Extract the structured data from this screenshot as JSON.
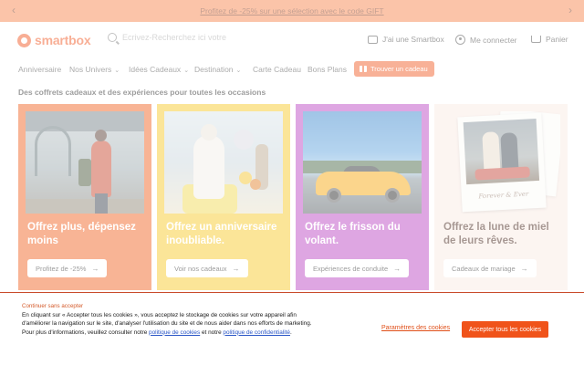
{
  "promo": {
    "text": "Profitez de -25% sur une sélection avec le code GIFT",
    "prev_icon": "chevron-left",
    "next_icon": "chevron-right"
  },
  "header": {
    "logo": "smartbox",
    "search_placeholder": "Ecrivez-Recherchez ici votre",
    "have_box_label": "J'ai une Smartbox",
    "login_label": "Me connecter",
    "cart_label": "Panier"
  },
  "nav": {
    "items": [
      {
        "label": "Anniversaire",
        "dropdown": false
      },
      {
        "label": "Nos Univers",
        "dropdown": true
      },
      {
        "label": "Idées Cadeaux",
        "dropdown": true
      },
      {
        "label": "Destination",
        "dropdown": true
      },
      {
        "label": "Carte Cadeau",
        "dropdown": false
      },
      {
        "label": "Bons Plans",
        "dropdown": false
      }
    ],
    "cta_label": "Trouver un cadeau",
    "chevron": "⌄"
  },
  "heading": "Des coffrets cadeaux et des expériences pour toutes les occasions",
  "cards": [
    {
      "title": "Offrez plus, dépensez moins",
      "cta": "Profitez de -25%"
    },
    {
      "title": "Offrez un anniversaire inoubliable.",
      "cta": "Voir nos cadeaux"
    },
    {
      "title": "Offrez le frisson du volant.",
      "cta": "Expériences de conduite"
    },
    {
      "title": "Offrez la lune de miel de leurs rêves.",
      "cta": "Cadeaux de mariage"
    }
  ],
  "card_photo4_caption": "Forever & Ever",
  "cookie": {
    "continue_label": "Continuer sans accepter",
    "text_before": "En cliquant sur « Accepter tous les cookies », vous acceptez le stockage de cookies sur votre appareil afin d'améliorer la navigation sur le site, d'analyser l'utilisation du site et de nous aider dans nos efforts de marketing. Pour plus d'informations, veuillez consulter notre ",
    "link_1": "politique de cookies",
    "text_middle": " et notre ",
    "link_2": "politique de confidentialité",
    "text_after": ".",
    "settings_label": "Paramètres des cookies",
    "accept_label": "Accepter tous les cookies"
  },
  "colors": {
    "brand": "#ef4d14",
    "promo_bg": "#f57c42",
    "card_1": "#ef5a16",
    "card_2": "#f6c51b",
    "card_3": "#b63bbf",
    "card_4": "#f9e9e1"
  }
}
